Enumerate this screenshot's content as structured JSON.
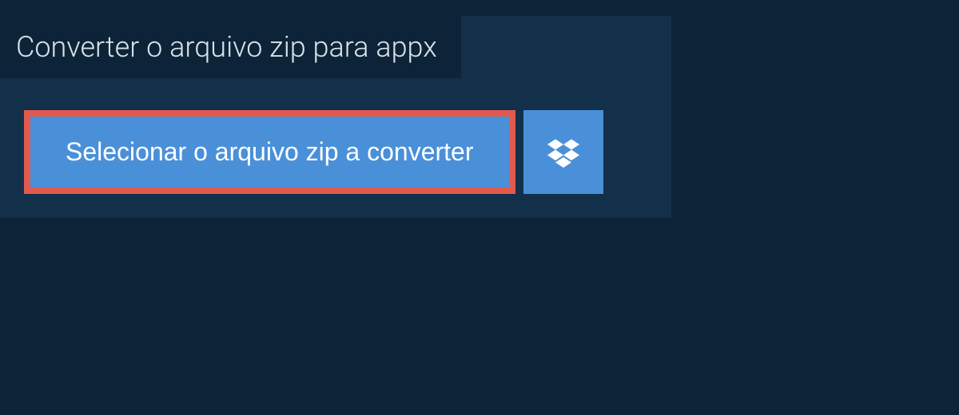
{
  "title": "Converter o arquivo zip para appx",
  "select_button_label": "Selecionar o arquivo zip a converter"
}
